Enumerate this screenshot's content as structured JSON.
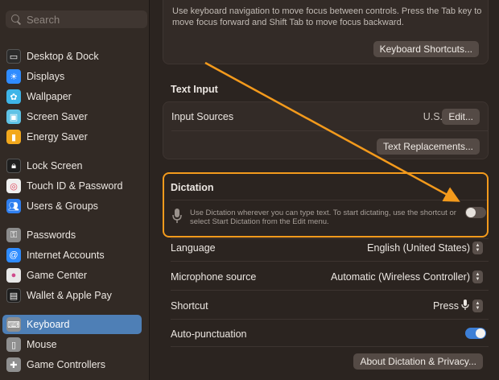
{
  "sidebar": {
    "search_placeholder": "Search",
    "items": [
      {
        "label": "Desktop & Dock",
        "icon": "dock-icon",
        "color": "#2b2b2b"
      },
      {
        "label": "Displays",
        "icon": "sun-icon",
        "color": "#2f8cff"
      },
      {
        "label": "Wallpaper",
        "icon": "flower-icon",
        "color": "#3eb5e8"
      },
      {
        "label": "Screen Saver",
        "icon": "screensaver-icon",
        "color": "#5fc3e6"
      },
      {
        "label": "Energy Saver",
        "icon": "battery-icon",
        "color": "#f2a81d"
      },
      {
        "label": "Lock Screen",
        "icon": "lock-icon",
        "color": "#1e1e1e"
      },
      {
        "label": "Touch ID & Password",
        "icon": "fingerprint-icon",
        "color": "#f0f0f0"
      },
      {
        "label": "Users & Groups",
        "icon": "users-icon",
        "color": "#2f7ff0"
      },
      {
        "label": "Passwords",
        "icon": "key-icon",
        "color": "#8b8b8b"
      },
      {
        "label": "Internet Accounts",
        "icon": "at-icon",
        "color": "#2f8cff"
      },
      {
        "label": "Game Center",
        "icon": "game-center-icon",
        "color": "#e8e8e8"
      },
      {
        "label": "Wallet & Apple Pay",
        "icon": "wallet-icon",
        "color": "#1e1e1e"
      },
      {
        "label": "Keyboard",
        "icon": "keyboard-icon",
        "color": "#8f8f8f",
        "active": true
      },
      {
        "label": "Mouse",
        "icon": "mouse-icon",
        "color": "#8f8f8f"
      },
      {
        "label": "Game Controllers",
        "icon": "gamepad-icon",
        "color": "#8f8f8f"
      }
    ]
  },
  "main": {
    "nav_hint": "Use keyboard navigation to move focus between controls. Press the Tab key to move focus forward and Shift Tab to move focus backward.",
    "keyboard_shortcuts_button": "Keyboard Shortcuts...",
    "text_input_title": "Text Input",
    "input_sources_label": "Input Sources",
    "input_sources_value": "U.S.",
    "edit_button": "Edit...",
    "text_replacements_button": "Text Replacements...",
    "dictation_title": "Dictation",
    "dictation_description": "Use Dictation wherever you can type text. To start dictating, use the shortcut or select Start Dictation from the Edit menu.",
    "dictation_enabled": false,
    "language_label": "Language",
    "language_value": "English (United States)",
    "microphone_label": "Microphone source",
    "microphone_value": "Automatic (Wireless Controller)",
    "shortcut_label": "Shortcut",
    "shortcut_value": "Press",
    "autopunct_label": "Auto-punctuation",
    "autopunct_enabled": true,
    "about_button": "About Dictation & Privacy..."
  },
  "colors": {
    "accent": "#4e7fb6",
    "annotation": "#f39a1c",
    "toggle_on": "#3d7fd6"
  }
}
